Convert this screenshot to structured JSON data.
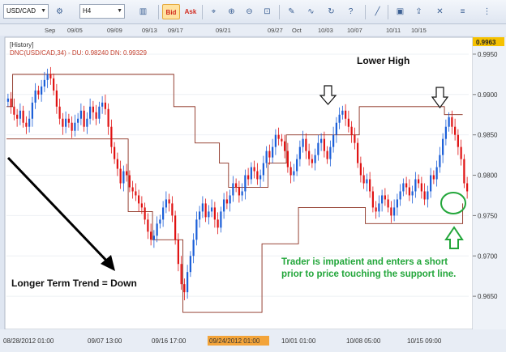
{
  "toolbar": {
    "symbol": "USD/CAD",
    "timeframe": "H4",
    "bid_label": "Bid",
    "ask_label": "Ask"
  },
  "chart_data": {
    "type": "candlestick",
    "symbol": "USD/CAD",
    "history_label": "[History]",
    "indicator_label": "DNC(USD/CAD,34) - DU: 0.98240 DN: 0.99329",
    "current_price_label": "0.9963",
    "y_ticks": [
      "0.9950",
      "0.9900",
      "0.9850",
      "0.9800",
      "0.9750",
      "0.9700",
      "0.9650"
    ],
    "ylim": [
      0.961,
      0.997
    ],
    "top_dates": [
      "Sep",
      "09/05",
      "09/09",
      "09/13",
      "09/17",
      "09/21",
      "09/27",
      "Oct",
      "10/03",
      "10/07",
      "10/11",
      "10/15"
    ],
    "bottom_dates": [
      "08/28/2012 01:00",
      "09/07 13:00",
      "09/16 17:00",
      "09/24/2012 01:00",
      "10/01 01:00",
      "10/08 05:00",
      "10/15 09:00"
    ],
    "highlighted_date": "09/24/2012 01:00",
    "close_path": [
      0.9895,
      0.9885,
      0.9875,
      0.987,
      0.988,
      0.9865,
      0.986,
      0.987,
      0.989,
      0.9905,
      0.99,
      0.991,
      0.9918,
      0.9925,
      0.992,
      0.9905,
      0.9885,
      0.987,
      0.986,
      0.987,
      0.9865,
      0.9855,
      0.9865,
      0.987,
      0.988,
      0.986,
      0.987,
      0.9885,
      0.9878,
      0.987,
      0.9885,
      0.989,
      0.9882,
      0.986,
      0.9835,
      0.982,
      0.9808,
      0.979,
      0.9805,
      0.98,
      0.9785,
      0.978,
      0.9775,
      0.9765,
      0.976,
      0.9745,
      0.973,
      0.972,
      0.9725,
      0.974,
      0.9745,
      0.976,
      0.977,
      0.9765,
      0.975,
      0.972,
      0.969,
      0.9665,
      0.9655,
      0.968,
      0.97,
      0.972,
      0.9745,
      0.9755,
      0.9765,
      0.9748,
      0.9755,
      0.976,
      0.9745,
      0.9735,
      0.9755,
      0.977,
      0.9765,
      0.9775,
      0.979,
      0.9785,
      0.9775,
      0.978,
      0.98,
      0.9795,
      0.981,
      0.9805,
      0.9795,
      0.98,
      0.9815,
      0.983,
      0.9822,
      0.9835,
      0.985,
      0.9845,
      0.9842,
      0.983,
      0.981,
      0.98,
      0.9805,
      0.982,
      0.9835,
      0.9845,
      0.983,
      0.982,
      0.9815,
      0.9825,
      0.984,
      0.9845,
      0.983,
      0.982,
      0.9835,
      0.985,
      0.9865,
      0.9875,
      0.988,
      0.987,
      0.986,
      0.985,
      0.984,
      0.9815,
      0.98,
      0.979,
      0.9795,
      0.978,
      0.976,
      0.9755,
      0.9765,
      0.9775,
      0.977,
      0.976,
      0.975,
      0.976,
      0.977,
      0.978,
      0.979,
      0.9785,
      0.9775,
      0.978,
      0.9795,
      0.979,
      0.978,
      0.977,
      0.978,
      0.98,
      0.9795,
      0.981,
      0.9825,
      0.9845,
      0.986,
      0.9872,
      0.986,
      0.985,
      0.9835,
      0.982,
      0.979,
      0.978
    ],
    "upper_channel": [
      [
        0,
        0.9885
      ],
      [
        2,
        0.9925
      ],
      [
        48,
        0.9925
      ],
      [
        55,
        0.9885
      ],
      [
        62,
        0.984
      ],
      [
        70,
        0.9815
      ],
      [
        73,
        0.9785
      ],
      [
        80,
        0.9785
      ],
      [
        86,
        0.9815
      ],
      [
        92,
        0.985
      ],
      [
        112,
        0.985
      ],
      [
        116,
        0.9885
      ],
      [
        140,
        0.9885
      ],
      [
        144,
        0.9875
      ],
      [
        150,
        0.9875
      ]
    ],
    "lower_channel": [
      [
        0,
        0.9845
      ],
      [
        34,
        0.9845
      ],
      [
        40,
        0.9755
      ],
      [
        48,
        0.972
      ],
      [
        56,
        0.972
      ],
      [
        58,
        0.963
      ],
      [
        82,
        0.963
      ],
      [
        84,
        0.9715
      ],
      [
        92,
        0.9715
      ],
      [
        96,
        0.976
      ],
      [
        112,
        0.976
      ],
      [
        118,
        0.974
      ],
      [
        144,
        0.974
      ],
      [
        150,
        0.9765
      ]
    ],
    "annotations": {
      "lower_high": "Lower High",
      "trend": "Longer Term Trend = Down",
      "trader_note_line1": "Trader is impatient and enters a short",
      "trader_note_line2": "prior to price touching the support line."
    },
    "colors": {
      "bull": "#1a5ed8",
      "bear": "#e01212",
      "channel": "#8b2e1f",
      "annotation_green": "#22a63a",
      "price_tag": "#f5c100",
      "date_highlight": "#f3a43a"
    }
  }
}
